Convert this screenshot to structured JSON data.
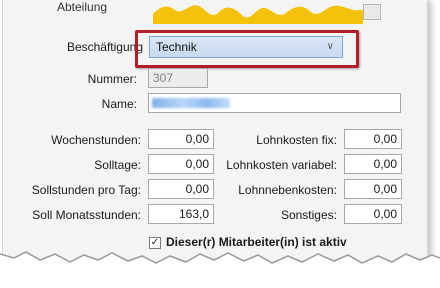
{
  "form": {
    "abteilung_label": "Abteilung",
    "beschaeftigung_label": "Beschäftigung",
    "beschaeftigung_value": "Technik",
    "nummer_label": "Nummer:",
    "nummer_value": "307",
    "name_label": "Name:",
    "name_value": ""
  },
  "left_fields": [
    {
      "label": "Wochenstunden:",
      "value": "0,00"
    },
    {
      "label": "Solltage:",
      "value": "0,00"
    },
    {
      "label": "Sollstunden pro Tag:",
      "value": "0,00"
    },
    {
      "label": "Soll Monatsstunden:",
      "value": "163,0"
    }
  ],
  "right_fields": [
    {
      "label": "Lohnkosten fix:",
      "value": "0,00"
    },
    {
      "label": "Lohnkosten variabel:",
      "value": "0,00"
    },
    {
      "label": "Lohnnebenkosten:",
      "value": "0,00"
    },
    {
      "label": "Sonstiges:",
      "value": "0,00"
    }
  ],
  "active_checkbox": {
    "label": "Dieser(r) Mitarbeiter(in) ist aktiv",
    "checked": true
  },
  "colors": {
    "highlight": "#b21e28",
    "select_fill": "#c8d9f1",
    "chart_fill": "#f4c20d"
  }
}
